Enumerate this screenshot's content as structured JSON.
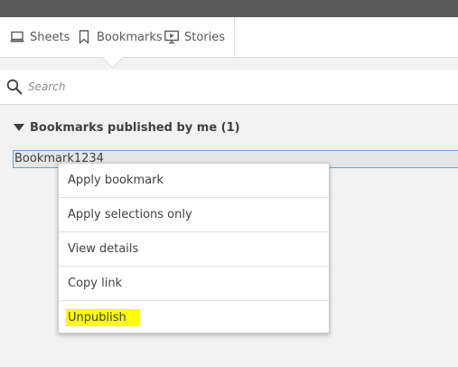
{
  "tabs": [
    {
      "label": "Sheets",
      "icon": "sheets-icon"
    },
    {
      "label": "Bookmarks",
      "icon": "bookmark-icon"
    },
    {
      "label": "Stories",
      "icon": "stories-icon"
    }
  ],
  "search": {
    "placeholder": "Search"
  },
  "section": {
    "title": "Bookmarks published by me (1)"
  },
  "bookmarks": [
    {
      "name": "Bookmark1234"
    }
  ],
  "context_menu": {
    "items": [
      {
        "label": "Apply bookmark"
      },
      {
        "label": "Apply selections only"
      },
      {
        "label": "View details"
      },
      {
        "label": "Copy link"
      },
      {
        "label": "Unpublish",
        "highlighted": true
      }
    ]
  },
  "colors": {
    "top_bar": "#595959",
    "highlight": "#ffff00",
    "selection_border": "#6aa3d8"
  }
}
